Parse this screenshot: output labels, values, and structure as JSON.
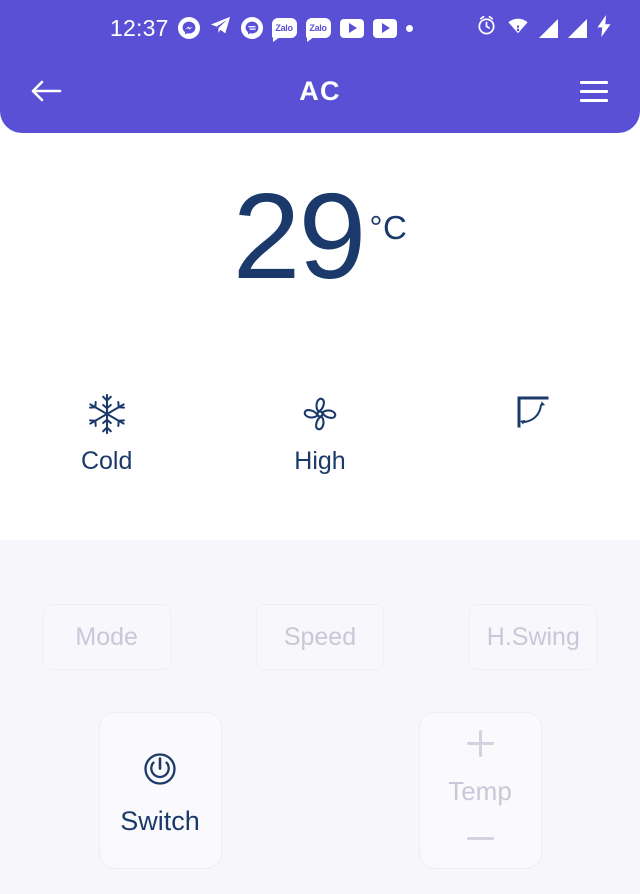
{
  "theme": {
    "accent": "#5a50d6",
    "navy": "#1b3a6b",
    "panel_bg": "#f6f6fb",
    "muted": "#c8c8d8"
  },
  "status_bar": {
    "clock": "12:37",
    "notification_icons": [
      {
        "name": "messenger-icon",
        "label": ""
      },
      {
        "name": "telegram-icon",
        "label": ""
      },
      {
        "name": "chat-bubble-icon",
        "label": ""
      },
      {
        "name": "zalo-icon",
        "label": "Zalo"
      },
      {
        "name": "zalo-icon",
        "label": "Zalo"
      },
      {
        "name": "youtube-icon",
        "label": ""
      },
      {
        "name": "youtube-icon",
        "label": ""
      },
      {
        "name": "more-dot-icon",
        "label": ""
      }
    ],
    "system_icons": [
      {
        "name": "alarm-clock-icon"
      },
      {
        "name": "wifi-icon"
      },
      {
        "name": "signal-bars-icon"
      },
      {
        "name": "signal-bars-icon"
      },
      {
        "name": "battery-charging-icon"
      }
    ]
  },
  "app_bar": {
    "back_label": "Back",
    "title": "AC",
    "menu_label": "Menu"
  },
  "status_panel": {
    "temperature": "29",
    "unit": "°C",
    "states": [
      {
        "icon": "snowflake-icon",
        "label": "Cold"
      },
      {
        "icon": "fan-icon",
        "label": "High"
      },
      {
        "icon": "swing-angle-icon",
        "label": ""
      }
    ]
  },
  "control_panel": {
    "chips": [
      {
        "label": "Mode",
        "name": "mode-button"
      },
      {
        "label": "Speed",
        "name": "speed-button"
      },
      {
        "label": "H.Swing",
        "name": "hswing-button"
      }
    ],
    "switch": {
      "icon": "power-icon",
      "label": "Switch"
    },
    "temp_stepper": {
      "increase": "+",
      "label": "Temp",
      "decrease": "−"
    }
  }
}
